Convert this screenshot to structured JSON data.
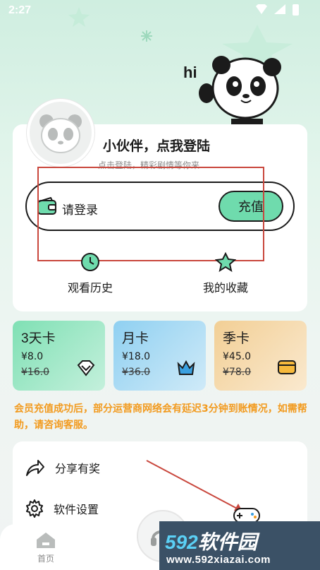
{
  "status_bar": {
    "time": "2:27"
  },
  "mascot": {
    "greeting": "hi"
  },
  "profile": {
    "title": "小伙伴，点我登陆",
    "subtitle": "点击登陆，精彩剧情等你来"
  },
  "recharge": {
    "label": "请登录",
    "button": "充值"
  },
  "quick_actions": [
    {
      "label": "观看历史",
      "icon": "history-icon"
    },
    {
      "label": "我的收藏",
      "icon": "favorites-icon"
    }
  ],
  "plans": [
    {
      "name": "3天卡",
      "price": "¥8.0",
      "original": "¥16.0",
      "icon": "diamond-icon",
      "color_start": "#7fe0b4",
      "color_end": "#c4f0dc"
    },
    {
      "name": "月卡",
      "price": "¥18.0",
      "original": "¥36.0",
      "icon": "crown-icon",
      "color_start": "#8fd0f1",
      "color_end": "#cfeaf8"
    },
    {
      "name": "季卡",
      "price": "¥45.0",
      "original": "¥78.0",
      "icon": "card-icon",
      "color_start": "#f2cf95",
      "color_end": "#fae9cf"
    }
  ],
  "notice": "会员充值成功后，部分运营商网络会有延迟3分钟到账情况，如需帮助，请咨询客服。",
  "menu": [
    {
      "label": "分享有奖",
      "icon": "share-icon"
    },
    {
      "label": "软件设置",
      "icon": "settings-icon"
    }
  ],
  "tabbar": {
    "home_label": "首页"
  },
  "watermark": {
    "brand_num": "592",
    "brand_text": "软件园",
    "url": "www.592xiazai.com"
  },
  "colors": {
    "accent": "#6fdbad",
    "notice": "#f29a1e",
    "highlight_box": "#c9473d"
  }
}
